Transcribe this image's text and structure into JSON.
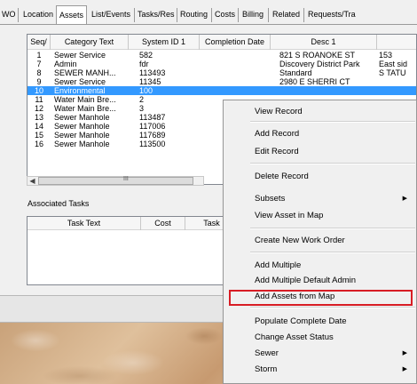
{
  "tabs": [
    "WO",
    "Location",
    "Assets",
    "List/Events",
    "Tasks/Res",
    "Routing",
    "Costs",
    "Billing",
    "Related",
    "Requests/Tra"
  ],
  "active_tab": "Assets",
  "assets_grid": {
    "headers": [
      "Seq",
      "Category Text",
      "System ID 1",
      "Completion Date",
      "Desc 1",
      ""
    ],
    "rows": [
      {
        "seq": "1",
        "category": "Sewer Service",
        "system_id": "582",
        "completion": "",
        "desc1": "821 S ROANOKE ST",
        "extra": "153"
      },
      {
        "seq": "7",
        "category": "Admin",
        "system_id": "fdr",
        "completion": "",
        "desc1": "Discovery District Park",
        "extra": "East sid"
      },
      {
        "seq": "8",
        "category": "SEWER MANH...",
        "system_id": "113493",
        "completion": "",
        "desc1": "Standard",
        "extra": "S TATU"
      },
      {
        "seq": "9",
        "category": "Sewer Service",
        "system_id": "11345",
        "completion": "",
        "desc1": "2980 E SHERRI CT",
        "extra": ""
      },
      {
        "seq": "10",
        "category": "Environmental",
        "system_id": "100",
        "completion": "",
        "desc1": "",
        "extra": ""
      },
      {
        "seq": "11",
        "category": "Water Main Bre...",
        "system_id": "2",
        "completion": "",
        "desc1": "",
        "extra": ""
      },
      {
        "seq": "12",
        "category": "Water Main Bre...",
        "system_id": "3",
        "completion": "",
        "desc1": "",
        "extra": ""
      },
      {
        "seq": "13",
        "category": "Sewer Manhole",
        "system_id": "113487",
        "completion": "",
        "desc1": "",
        "extra": ""
      },
      {
        "seq": "14",
        "category": "Sewer Manhole",
        "system_id": "117006",
        "completion": "",
        "desc1": "",
        "extra": ""
      },
      {
        "seq": "15",
        "category": "Sewer Manhole",
        "system_id": "117689",
        "completion": "",
        "desc1": "",
        "extra": ""
      },
      {
        "seq": "16",
        "category": "Sewer Manhole",
        "system_id": "113500",
        "completion": "",
        "desc1": "",
        "extra": ""
      }
    ],
    "selected_row_seq": "10",
    "scroll_grip": "III"
  },
  "associated_tasks": {
    "label": "Associated Tasks",
    "headers": [
      "Task Text",
      "Cost",
      "Task"
    ]
  },
  "context_menu": {
    "items": [
      {
        "label": "View Record",
        "submenu": false
      },
      {
        "label": "Add Record",
        "submenu": false
      },
      {
        "label": "Edit Record",
        "submenu": false
      },
      {
        "label": "Delete Record",
        "submenu": false
      },
      {
        "label": "Subsets",
        "submenu": true
      },
      {
        "label": "View Asset in Map",
        "submenu": false
      },
      {
        "label": "Create New Work Order",
        "submenu": false
      },
      {
        "label": "Add Multiple",
        "submenu": false
      },
      {
        "label": "Add Multiple Default Admin",
        "submenu": false
      },
      {
        "label": "Add Assets from Map",
        "submenu": false
      },
      {
        "label": "Populate Complete Date",
        "submenu": false
      },
      {
        "label": "Change Asset Status",
        "submenu": false
      },
      {
        "label": "Sewer",
        "submenu": true
      },
      {
        "label": "Storm",
        "submenu": true
      }
    ],
    "highlighted_item": "Add Assets from Map"
  },
  "colors": {
    "selection": "#3399ff",
    "highlight_border": "#d81d25"
  }
}
